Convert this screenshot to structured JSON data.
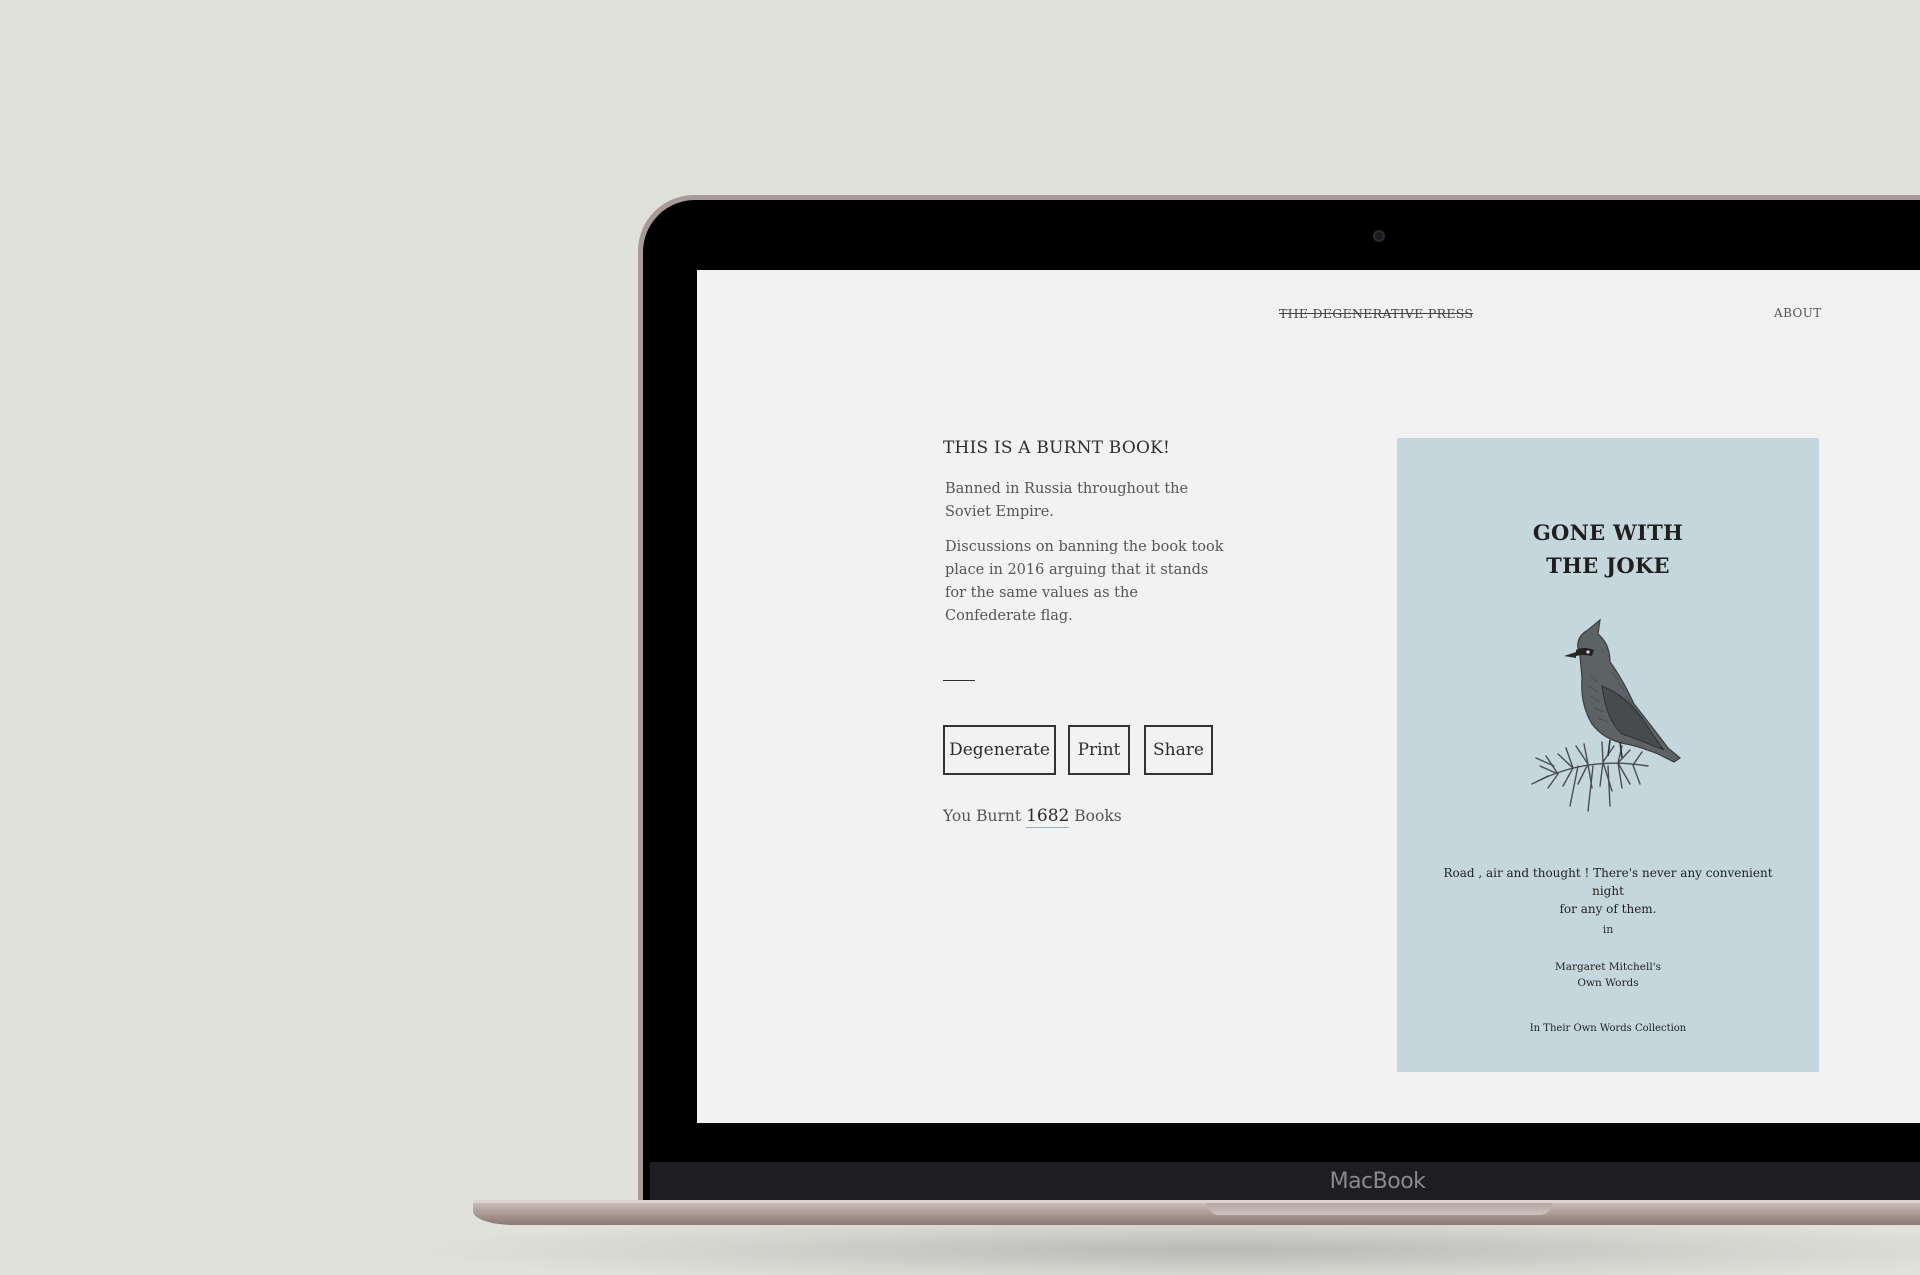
{
  "site": {
    "logo": "THE DEGENERATIVE PRESS",
    "nav_about": "ABOUT"
  },
  "book_info": {
    "heading": "THIS IS A BURNT BOOK!",
    "paragraph_1": "Banned in Russia throughout the Soviet Empire.",
    "paragraph_2": "Discussions on banning the book took place in 2016 arguing that it stands for the same values as the Confederate flag."
  },
  "actions": {
    "degenerate_label": "Degenerate",
    "print_label": "Print",
    "share_label": "Share"
  },
  "counter": {
    "prefix": "You Burnt",
    "count": "1682",
    "suffix": "Books"
  },
  "cover": {
    "title_line_1": "GONE WITH",
    "title_line_2": "THE JOKE",
    "illustration": "waxwing-bird-on-branch",
    "quote_line_1": "Road , air and thought ! There's never any convenient night",
    "quote_line_2": "for any of them.",
    "in_word": "in",
    "author_line_1": "Margaret Mitchell's",
    "author_line_2": "Own Words",
    "collection": "In Their Own Words Collection",
    "background_color": "#c5d7dc"
  },
  "device": {
    "brand": "MacBook"
  },
  "colors": {
    "page_background": "#e1e1dc",
    "screen_background": "#f2f2f2",
    "count_underline": "#8fb6c7"
  }
}
